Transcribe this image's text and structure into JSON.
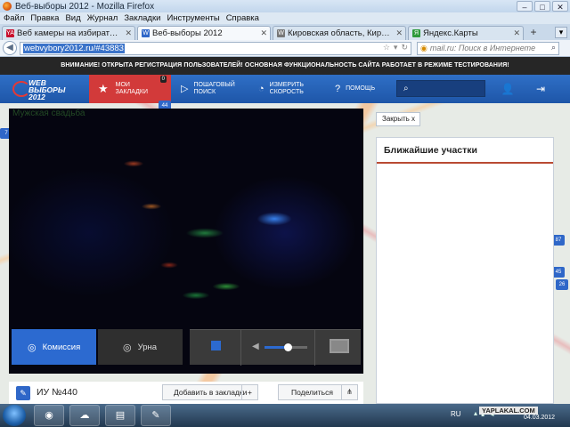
{
  "window": {
    "title": "Веб-выборы 2012 - Mozilla Firefox",
    "controls": [
      "–",
      "□",
      "✕"
    ]
  },
  "menu": [
    "Файл",
    "Правка",
    "Вид",
    "Журнал",
    "Закладки",
    "Инструменты",
    "Справка"
  ],
  "tabs": [
    {
      "label": "Веб камеры на избирательных уча...",
      "favicon": "YA"
    },
    {
      "label": "Веб-выборы 2012",
      "favicon": "W"
    },
    {
      "label": "Кировская область, Киров, Гайдар...",
      "favicon": "W"
    },
    {
      "label": "Яндекс.Карты",
      "favicon": "Я"
    }
  ],
  "navbar": {
    "url": "webvybory2012.ru/#43883",
    "search_placeholder": "mail.ru: Поиск в Интернете"
  },
  "site": {
    "banner": "ВНИМАНИЕ! ОТКРЫТА РЕГИСТРАЦИЯ ПОЛЬЗОВАТЕЛЕЙ! ОСНОВНАЯ ФУНКЦИОНАЛЬНОСТЬ САЙТА РАБОТАЕТ В РЕЖИМЕ ТЕСТИРОВАНИЯ!",
    "logo_line1": "WEB",
    "logo_line2": "ВЫБОРЫ",
    "logo_line3": "2012",
    "nav": {
      "bookmarks_line1": "МОИ",
      "bookmarks_line2": "ЗАКЛАДКИ",
      "bookmarks_count": "0",
      "search_line1": "ПОШАГОВЫЙ",
      "search_line2": "ПОИСК",
      "speed_line1": "ИЗМЕРИТЬ",
      "speed_line2": "СКОРОСТЬ",
      "help": "ПОМОЩЬ"
    },
    "map_pins": [
      "44",
      "7",
      "87",
      "45",
      "26"
    ],
    "video": {
      "overlay_text": "Мужская свадьба",
      "commission_label": "Комиссия",
      "urn_label": "Урна",
      "volume": 0.55
    },
    "close_label": "Закрыть  x",
    "side_title": "Ближайшие участки",
    "station_name": "ИУ №440",
    "add_bookmark_label": "Добавить в закладки",
    "share_label": "Поделиться"
  },
  "taskbar": {
    "lang": "RU",
    "date": "04.03.2012",
    "watermark": "YAPLAKAL.COM"
  }
}
